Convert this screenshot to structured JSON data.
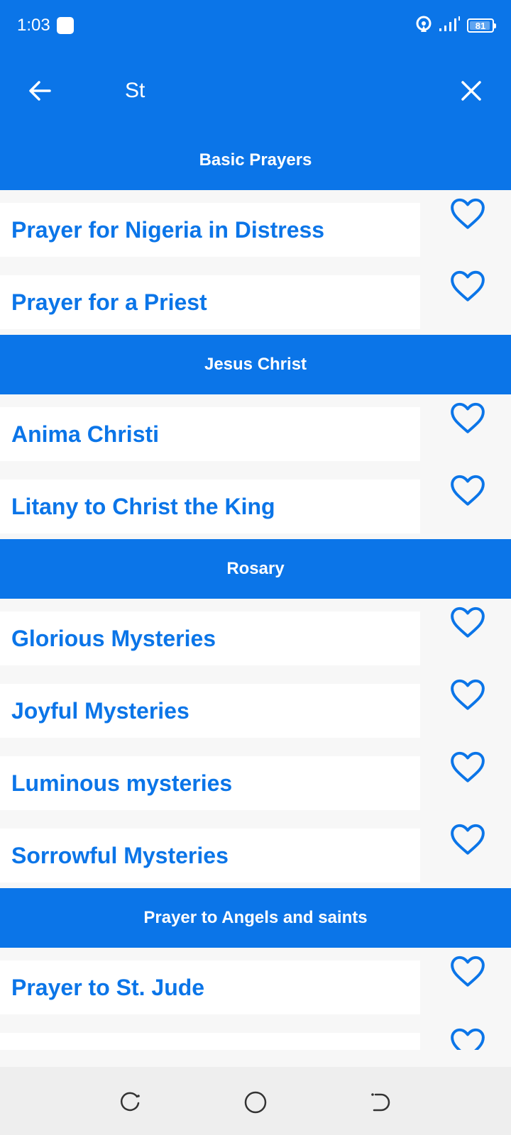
{
  "status_bar": {
    "time": "1:03",
    "battery_level": "81",
    "icons": [
      "app-notification-icon",
      "hotspot-icon",
      "signal-icon",
      "battery-icon"
    ]
  },
  "app_bar": {
    "search_value": "St",
    "icons": [
      "arrow-left-icon",
      "close-icon"
    ]
  },
  "sections": [
    {
      "title": "Basic Prayers",
      "items": [
        {
          "title": "Prayer for Nigeria in Distress"
        },
        {
          "title": "Prayer for a Priest"
        }
      ]
    },
    {
      "title": "Jesus Christ",
      "items": [
        {
          "title": "Anima Christi"
        },
        {
          "title": "Litany to Christ the King"
        }
      ]
    },
    {
      "title": "Rosary",
      "items": [
        {
          "title": "Glorious Mysteries"
        },
        {
          "title": "Joyful Mysteries"
        },
        {
          "title": "Luminous mysteries"
        },
        {
          "title": "Sorrowful Mysteries"
        }
      ]
    },
    {
      "title": "Prayer to Angels and saints",
      "items": [
        {
          "title": "Prayer to St. Jude"
        },
        {
          "title": ""
        }
      ]
    }
  ],
  "nav_bar": {
    "icons": [
      "recent-apps-icon",
      "home-icon",
      "back-icon"
    ]
  },
  "colors": {
    "accent": "#0b75e8",
    "background": "#f7f7f7",
    "card": "#ffffff",
    "nav_bar": "#eeeeee"
  }
}
